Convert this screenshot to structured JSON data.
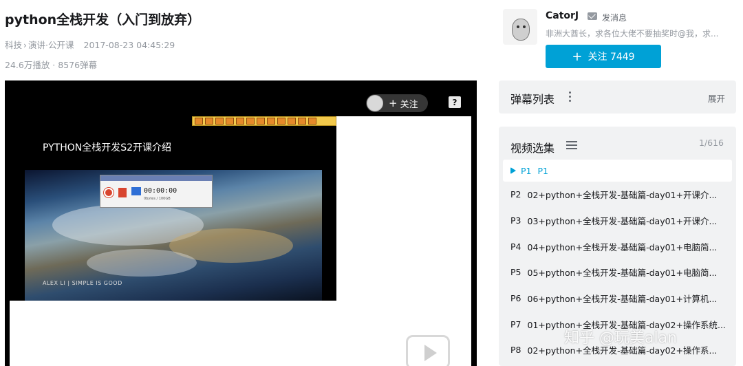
{
  "video": {
    "title": "python全栈开发（入门到放弃）",
    "category": "科技",
    "subcategory": "演讲·公开课",
    "date": "2017-08-23 04:45:29",
    "stats": "24.6万播放 · 8576弹幕"
  },
  "player": {
    "follow_label": "关注",
    "help_label": "?",
    "slide_title": "PYTHON全栈开发S2开课介绍",
    "slide_footer": "ALEX LI | SIMPLE IS GOOD",
    "recorder_time": "00:00:00",
    "recorder_size": "0bytes / 100GB"
  },
  "uploader": {
    "name": "CatorJ",
    "message_label": "发消息",
    "description": "非洲大酋长，求各位大佬不要抽奖时@我，求...",
    "follow_button": "关注 7449"
  },
  "danmaku": {
    "title": "弹幕列表",
    "expand_label": "展开"
  },
  "episodes": {
    "title": "视频选集",
    "count": "1/616",
    "items": [
      {
        "num": "P1",
        "label": "P1"
      },
      {
        "num": "P2",
        "label": "02+python+全栈开发-基础篇-day01+开课介..."
      },
      {
        "num": "P3",
        "label": "03+python+全栈开发-基础篇-day01+开课介..."
      },
      {
        "num": "P4",
        "label": "04+python+全栈开发-基础篇-day01+电脑简..."
      },
      {
        "num": "P5",
        "label": "05+python+全栈开发-基础篇-day01+电脑简..."
      },
      {
        "num": "P6",
        "label": "06+python+全栈开发-基础篇-day01+计算机..."
      },
      {
        "num": "P7",
        "label": "01+python+全栈开发-基础篇-day02+操作系统..."
      },
      {
        "num": "P8",
        "label": "02+python+全栈开发-基础篇-day02+操作系..."
      }
    ]
  },
  "watermark": "知乎 @玩美alan",
  "colors": {
    "accent": "#00a1d6",
    "panel_bg": "#f1f2f3",
    "muted_text": "#9499a0"
  }
}
